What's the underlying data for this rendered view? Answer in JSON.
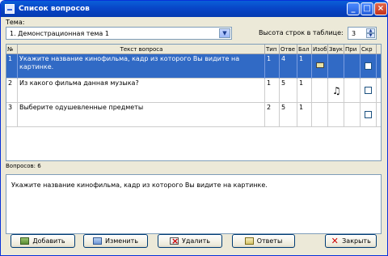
{
  "window": {
    "title": "Список вопросов"
  },
  "topic": {
    "label": "Тема:",
    "value": "1. Демонстрационная тема 1"
  },
  "row_height": {
    "label": "Высота строк в таблице:",
    "value": "3"
  },
  "table": {
    "columns": [
      "№",
      "Текст вопроса",
      "Тип",
      "Отве",
      "Бал",
      "Изоб",
      "Звук",
      "При",
      "Скр"
    ],
    "rows": [
      {
        "num": "1",
        "text": "Укажите название кинофильма, кадр из которого Вы видите на картинке.",
        "type": "1",
        "answers": "4",
        "score": "1",
        "has_image": true,
        "has_sound": false,
        "selected": true
      },
      {
        "num": "2",
        "text": "Из какого фильма данная музыка?",
        "type": "1",
        "answers": "5",
        "score": "1",
        "has_image": false,
        "has_sound": true,
        "selected": false
      },
      {
        "num": "3",
        "text": "Выберите одушевленные предметы",
        "type": "2",
        "answers": "5",
        "score": "1",
        "has_image": false,
        "has_sound": false,
        "selected": false
      }
    ]
  },
  "status": {
    "count_text": "Вопросов: 6"
  },
  "preview": {
    "text": "Укажите название кинофильма, кадр из которого Вы видите на картинке."
  },
  "buttons": {
    "add": "Добавить",
    "edit": "Изменить",
    "delete": "Удалить",
    "answers": "Ответы",
    "close": "Закрыть"
  },
  "icons": {
    "sound": "♫"
  }
}
